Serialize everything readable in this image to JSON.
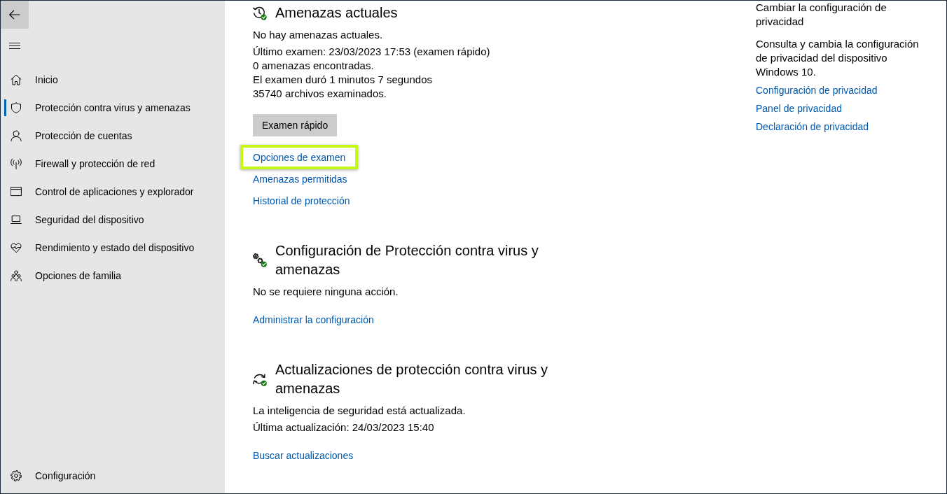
{
  "sidebar": {
    "items": [
      {
        "label": "Inicio",
        "selected": false
      },
      {
        "label": "Protección contra virus y amenazas",
        "selected": true
      },
      {
        "label": "Protección de cuentas",
        "selected": false
      },
      {
        "label": "Firewall y protección de red",
        "selected": false
      },
      {
        "label": "Control de aplicaciones y explorador",
        "selected": false
      },
      {
        "label": "Seguridad del dispositivo",
        "selected": false
      },
      {
        "label": "Rendimiento y estado del dispositivo",
        "selected": false
      },
      {
        "label": "Opciones de familia",
        "selected": false
      }
    ],
    "settings_item": {
      "label": "Configuración"
    }
  },
  "sections": [
    {
      "title": "Amenazas actuales",
      "status": "No hay amenazas actuales.",
      "details": [
        "Último examen: 23/03/2023 17:53 (examen rápido)",
        "0 amenazas encontradas.",
        "El examen duró 1 minutos 7 segundos",
        "35740 archivos examinados."
      ],
      "button": "Examen rápido",
      "links": [
        {
          "label": "Opciones de examen",
          "highlighted": true
        },
        {
          "label": "Amenazas permitidas",
          "highlighted": false
        },
        {
          "label": "Historial de protección",
          "highlighted": false
        }
      ]
    },
    {
      "title": "Configuración de Protección contra virus y amenazas",
      "status": "No se requiere ninguna acción.",
      "links": [
        {
          "label": "Administrar la configuración",
          "highlighted": false
        }
      ]
    },
    {
      "title": "Actualizaciones de protección contra virus y amenazas",
      "status": "La inteligencia de seguridad está actualizada.",
      "details": [
        "Última actualización: 24/03/2023 15:40"
      ],
      "links": [
        {
          "label": "Buscar actualizaciones",
          "highlighted": false
        }
      ]
    }
  ],
  "privacy": {
    "title": "Cambiar la configuración de privacidad",
    "description": "Consulta y cambia la configuración de privacidad del dispositivo Windows 10.",
    "links": [
      "Configuración de privacidad",
      "Panel de privacidad",
      "Declaración de privacidad"
    ]
  }
}
